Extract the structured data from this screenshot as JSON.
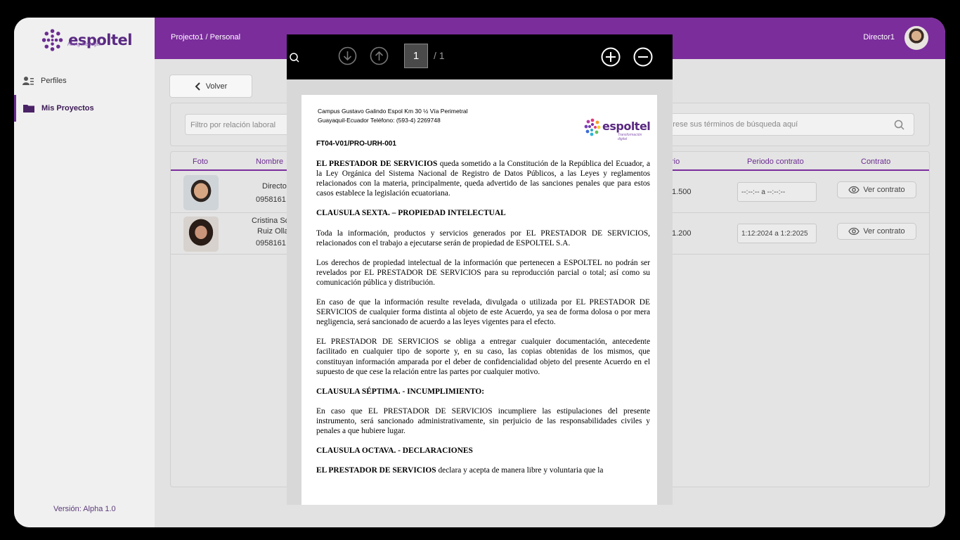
{
  "app": {
    "logo_text": "espoltel",
    "logo_sub": "Hiring Manager",
    "breadcrumb": "Projecto1 / Personal",
    "user_name": "Director1",
    "version": "Versión: Alpha 1.0"
  },
  "sidebar": {
    "items": [
      {
        "label": "Perfiles",
        "icon": "user-list-icon"
      },
      {
        "label": "Mis Proyectos",
        "icon": "folder-icon"
      }
    ]
  },
  "main": {
    "back_label": "Volver",
    "filter_placeholder": "Filtro por relación laboral",
    "search_placeholder": "Ingrese sus términos de búsqueda aquí",
    "columns": [
      "Foto",
      "Nombre",
      "Salario",
      "Periodo contrato",
      "Contrato"
    ],
    "rows": [
      {
        "name_line1": "Directo",
        "name_line2": "",
        "phone": "0958161",
        "salary": "1.500",
        "period": "--:--:-- a --:--:--",
        "action": "Ver contrato"
      },
      {
        "name_line1": "Cristina Sc",
        "name_line2": "Ruiz Olla",
        "phone": "0958161",
        "salary": "1.200",
        "period": "1:12:2024 a 1:2:2025",
        "action": "Ver contrato"
      }
    ]
  },
  "viewer": {
    "page_current": "1",
    "page_total": "/ 1",
    "doc": {
      "address_line1": "Campus Gustavo Galindo Espol Km 30 ½ Vía Perimetral",
      "address_line2": "Guayaquil-Ecuador Teléfono: (593-4) 2269748",
      "logo_text": "espoltel",
      "logo_sub": "Transformación digital",
      "code": "FT04-V01/PRO-URH-001",
      "p1_bold": "EL PRESTADOR DE SERVICIOS",
      "p1_rest": " queda sometido a la Constitución de la República del Ecuador, a la Ley Orgánica del Sistema Nacional de Registro de Datos Públicos, a las Leyes y reglamentos relacionados con la materia, principalmente, queda advertido de las sanciones penales que para estos casos establece la legislación ecuatoriana.",
      "h1": "CLAUSULA SEXTA. – PROPIEDAD INTELECTUAL",
      "p2": "Toda la información, productos y servicios generados por EL PRESTADOR DE SERVICIOS, relacionados con el trabajo a ejecutarse serán de propiedad de ESPOLTEL S.A.",
      "p3": "Los derechos de propiedad intelectual de la información que pertenecen a ESPOLTEL no podrán ser revelados por EL PRESTADOR DE SERVICIOS para su reproducción parcial o total; así como su comunicación pública y distribución.",
      "p4": "En caso de que la información resulte revelada, divulgada o utilizada por EL PRESTADOR DE SERVICIOS de cualquier forma distinta al objeto de este Acuerdo, ya sea de forma dolosa o por mera negligencia, será sancionado de acuerdo a las leyes vigentes para el efecto.",
      "p5": "EL PRESTADOR DE SERVICIOS se obliga a entregar cualquier documentación, antecedente facilitado en cualquier tipo de soporte y, en su caso, las copias obtenidas de los mismos, que constituyan información amparada por el deber de confidencialidad objeto del presente Acuerdo en el supuesto de que cese la relación entre las partes por cualquier motivo.",
      "h2": "CLAUSULA SÉPTIMA. - INCUMPLIMIENTO:",
      "p6": "En caso que EL PRESTADOR DE SERVICIOS incumpliere las estipulaciones del presente instrumento, será sancionado administrativamente, sin perjuicio de las responsabilidades civiles y penales a que hubiere lugar.",
      "h3": "CLAUSULA OCTAVA. - DECLARACIONES",
      "p7_bold": "EL PRESTADOR DE SERVICIOS",
      "p7_rest": " declara y acepta de manera libre y voluntaria que la"
    }
  },
  "colors": {
    "primary": "#7b2d9c",
    "background": "#ececec"
  }
}
